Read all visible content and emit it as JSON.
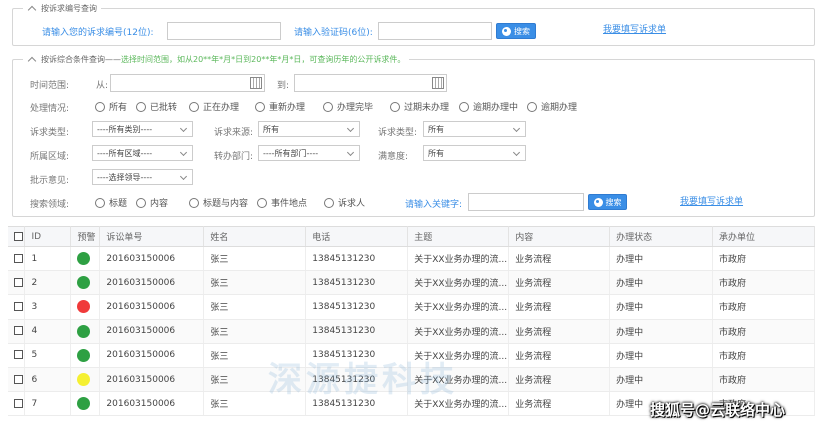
{
  "section1": {
    "legend": "按诉求编号查询",
    "code_label": "请输入您的诉求编号(12位):",
    "verify_label": "请输入验证码(6位):",
    "search_label": "搜索",
    "link": "我要填写诉求单"
  },
  "section2": {
    "legend": "按诉综合条件查询——",
    "legend_hint": "选择时间范围，如从20**年*月*日到20**年*月*日，可查询历年的公开诉求件。",
    "time_label": "时间范围:",
    "from_label": "从:",
    "to_label": "到:",
    "status_label": "处理情况:",
    "status_options": [
      "所有",
      "已批转",
      "正在办理",
      "重新办理",
      "办理完毕",
      "过期未办理",
      "逾期办理中",
      "逾期办理"
    ],
    "type_label": "诉求类型:",
    "type_value": "----所有类别----",
    "source_label": "诉求来源:",
    "source_value": "所有",
    "type2_label": "诉求类型:",
    "type2_value": "所有",
    "region_label": "所属区域:",
    "region_value": "----所有区域----",
    "dept_label": "转办部门:",
    "dept_value": "----所有部门----",
    "satisfaction_label": "满意度:",
    "satisfaction_value": "所有",
    "approval_label": "批示意见:",
    "approval_value": "----选择领导----",
    "field_label": "搜索领域:",
    "field_options": [
      "标题",
      "内容",
      "标题与内容",
      "事件地点",
      "诉求人"
    ],
    "keyword_label": "请输入关键字:",
    "search_label": "搜索",
    "link": "我要填写诉求单"
  },
  "table": {
    "headers": [
      "ID",
      "预警",
      "诉讼单号",
      "姓名",
      "电话",
      "主题",
      "内容",
      "办理状态",
      "承办单位"
    ],
    "rows": [
      {
        "id": "1",
        "alert": "#2ea043",
        "no": "201603150006",
        "name": "张三",
        "phone": "13845131230",
        "subject": "关于XX业务办理的流...",
        "content": "业务流程",
        "status": "办理中",
        "unit": "市政府"
      },
      {
        "id": "2",
        "alert": "#2ea043",
        "no": "201603150006",
        "name": "张三",
        "phone": "13845131230",
        "subject": "关于XX业务办理的流...",
        "content": "业务流程",
        "status": "办理中",
        "unit": "市政府"
      },
      {
        "id": "3",
        "alert": "#f03a3a",
        "no": "201603150006",
        "name": "张三",
        "phone": "13845131230",
        "subject": "关于XX业务办理的流...",
        "content": "业务流程",
        "status": "办理中",
        "unit": "市政府"
      },
      {
        "id": "4",
        "alert": "#2ea043",
        "no": "201603150006",
        "name": "张三",
        "phone": "13845131230",
        "subject": "关于XX业务办理的流...",
        "content": "业务流程",
        "status": "办理中",
        "unit": "市政府"
      },
      {
        "id": "5",
        "alert": "#2ea043",
        "no": "201603150006",
        "name": "张三",
        "phone": "13845131230",
        "subject": "关于XX业务办理的流...",
        "content": "业务流程",
        "status": "办理中",
        "unit": "市政府"
      },
      {
        "id": "6",
        "alert": "#f5f032",
        "no": "201603150006",
        "name": "张三",
        "phone": "13845131230",
        "subject": "关于XX业务办理的流...",
        "content": "业务流程",
        "status": "办理中",
        "unit": "市政府"
      },
      {
        "id": "7",
        "alert": "#2ea043",
        "no": "201603150006",
        "name": "张三",
        "phone": "13845131230",
        "subject": "关于XX业务办理的流...",
        "content": "业务流程",
        "status": "办理中",
        "unit": "市政府"
      }
    ]
  },
  "watermark": "深源捷科技",
  "watermark2": "搜狐号@云联络中心"
}
